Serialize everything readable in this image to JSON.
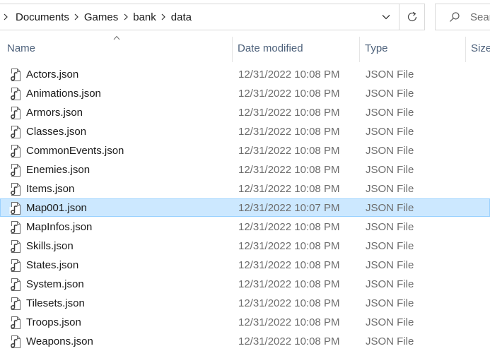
{
  "address_bar": {
    "breadcrumbs": [
      "Documents",
      "Games",
      "bank",
      "data"
    ],
    "dropdown_icon": "chevron-down-icon",
    "refresh_icon": "refresh-icon"
  },
  "search": {
    "placeholder": "Search",
    "visible_text": "Sear",
    "icon": "search-icon"
  },
  "columns": {
    "name": "Name",
    "date": "Date modified",
    "type": "Type",
    "size": "Size"
  },
  "sort": {
    "column": "Name",
    "direction": "ascending"
  },
  "colors": {
    "selection_bg": "#cce8ff",
    "selection_border": "#99d1ff",
    "header_text": "#4c607a",
    "secondary_text": "#6d6d6d"
  },
  "files": [
    {
      "name": "Actors.json",
      "date": "12/31/2022 10:08 PM",
      "type": "JSON File",
      "selected": false
    },
    {
      "name": "Animations.json",
      "date": "12/31/2022 10:08 PM",
      "type": "JSON File",
      "selected": false
    },
    {
      "name": "Armors.json",
      "date": "12/31/2022 10:08 PM",
      "type": "JSON File",
      "selected": false
    },
    {
      "name": "Classes.json",
      "date": "12/31/2022 10:08 PM",
      "type": "JSON File",
      "selected": false
    },
    {
      "name": "CommonEvents.json",
      "date": "12/31/2022 10:08 PM",
      "type": "JSON File",
      "selected": false
    },
    {
      "name": "Enemies.json",
      "date": "12/31/2022 10:08 PM",
      "type": "JSON File",
      "selected": false
    },
    {
      "name": "Items.json",
      "date": "12/31/2022 10:08 PM",
      "type": "JSON File",
      "selected": false
    },
    {
      "name": "Map001.json",
      "date": "12/31/2022 10:07 PM",
      "type": "JSON File",
      "selected": true
    },
    {
      "name": "MapInfos.json",
      "date": "12/31/2022 10:08 PM",
      "type": "JSON File",
      "selected": false
    },
    {
      "name": "Skills.json",
      "date": "12/31/2022 10:08 PM",
      "type": "JSON File",
      "selected": false
    },
    {
      "name": "States.json",
      "date": "12/31/2022 10:08 PM",
      "type": "JSON File",
      "selected": false
    },
    {
      "name": "System.json",
      "date": "12/31/2022 10:08 PM",
      "type": "JSON File",
      "selected": false
    },
    {
      "name": "Tilesets.json",
      "date": "12/31/2022 10:08 PM",
      "type": "JSON File",
      "selected": false
    },
    {
      "name": "Troops.json",
      "date": "12/31/2022 10:08 PM",
      "type": "JSON File",
      "selected": false
    },
    {
      "name": "Weapons.json",
      "date": "12/31/2022 10:08 PM",
      "type": "JSON File",
      "selected": false
    }
  ]
}
